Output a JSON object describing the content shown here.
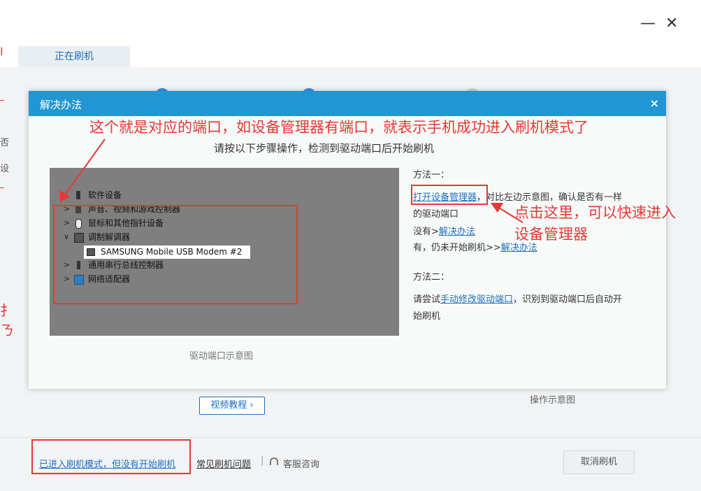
{
  "window": {
    "minimize_glyph": "—",
    "close_glyph": "✕",
    "tab_label": "正在刷机"
  },
  "dialog": {
    "title": "解决办法",
    "close_glyph": "×",
    "instruction": "请按以下步骤操作，检测到驱动端口后开始刷机",
    "screenshot": {
      "caption": "驱动端口示意图",
      "tree": [
        {
          "label": "软件设备",
          "icon": "software-device-icon",
          "expanded": false
        },
        {
          "label": "声音、视频和游戏控制器",
          "icon": "speaker-icon",
          "expanded": false
        },
        {
          "label": "鼠标和其他指针设备",
          "icon": "mouse-icon",
          "expanded": false
        },
        {
          "label": "调制解调器",
          "icon": "modem-icon",
          "expanded": true
        },
        {
          "label": "通用串行总线控制器",
          "icon": "usb-icon",
          "expanded": false
        },
        {
          "label": "网络适配器",
          "icon": "network-adapter-icon",
          "expanded": false
        }
      ],
      "modem_child": "SAMSUNG Mobile USB Modem #2"
    },
    "method1": {
      "heading": "方法一：",
      "link_open": "打开设备管理器",
      "text_after_link": "，对比左边示意图，确认是否有一样",
      "text_line2": "的驱动端口",
      "no_prefix": "没有>",
      "no_link": "解决办法",
      "yes_prefix": "有，仍未开始刷机>>",
      "yes_link": "解决办法"
    },
    "method2": {
      "heading": "方法二：",
      "prefix": "请尝试",
      "link": "手动修改驱动端口",
      "suffix": "，识别到驱动端口后自动开",
      "line2": "始刷机"
    }
  },
  "annotations": {
    "top": "这个就是对应的端口，如设备管理器有端口，就表示手机成功进入刷机模式了",
    "right_line1": "点击这里，可以快速进入",
    "right_line2": "设备管理器"
  },
  "background": {
    "video_button": "视频教程",
    "video_chevron": "›",
    "op_caption": "操作示意图",
    "edge_chars": [
      "Ⅰ",
      "否",
      "扌",
      "ㄋ",
      "设"
    ]
  },
  "footer": {
    "link_flash_mode": "已进入刷机模式，但没有开始刷机",
    "link_faq": "常见刷机问题",
    "separator": "|",
    "support": "客服咨询",
    "cancel": "取消刷机"
  },
  "colors": {
    "accent": "#2196d3",
    "link": "#1e6fc0",
    "annotation_red": "#e53935"
  }
}
